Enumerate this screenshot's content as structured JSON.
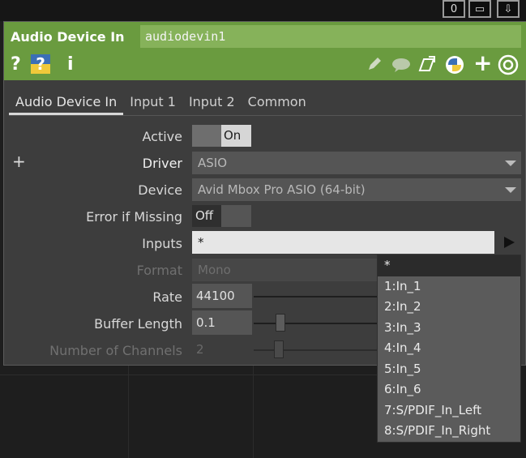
{
  "topbar": {
    "btn1": "0",
    "btn2": "▭",
    "btn3": "⇩"
  },
  "header": {
    "op_type": "Audio Device In",
    "op_name": "audiodevin1",
    "icons": [
      "help-icon",
      "python-help-icon",
      "info-icon",
      "edit-icon",
      "comment-icon",
      "clone-icon",
      "python-icon",
      "add-icon",
      "target-icon"
    ],
    "help_glyph": "?",
    "info_glyph": "i",
    "add_glyph": "+"
  },
  "tabs": [
    {
      "label": "Audio Device In"
    },
    {
      "label": "Input 1"
    },
    {
      "label": "Input 2"
    },
    {
      "label": "Common"
    }
  ],
  "params": {
    "active": {
      "label": "Active",
      "value": "On"
    },
    "driver": {
      "label": "Driver",
      "value": "ASIO"
    },
    "device": {
      "label": "Device",
      "value": "Avid Mbox Pro ASIO (64-bit)"
    },
    "error_if_missing": {
      "label": "Error if Missing",
      "value": "Off"
    },
    "inputs": {
      "label": "Inputs",
      "value": "*"
    },
    "format": {
      "label": "Format",
      "value": "Mono"
    },
    "rate": {
      "label": "Rate",
      "value": "44100"
    },
    "buffer_length": {
      "label": "Buffer Length",
      "value": "0.1"
    },
    "num_channels": {
      "label": "Number of Channels",
      "value": "2"
    }
  },
  "plus_label": "+",
  "inputs_menu": {
    "items": [
      "*",
      "1:In_1",
      "2:In_2",
      "3:In_3",
      "4:In_4",
      "5:In_5",
      "6:In_6",
      "7:S/PDIF_In_Left",
      "8:S/PDIF_In_Right"
    ]
  },
  "colors": {
    "header_green": "#6a9b3f",
    "panel_bg": "#3d3d3d",
    "menu_bg": "#5b5b5b"
  }
}
